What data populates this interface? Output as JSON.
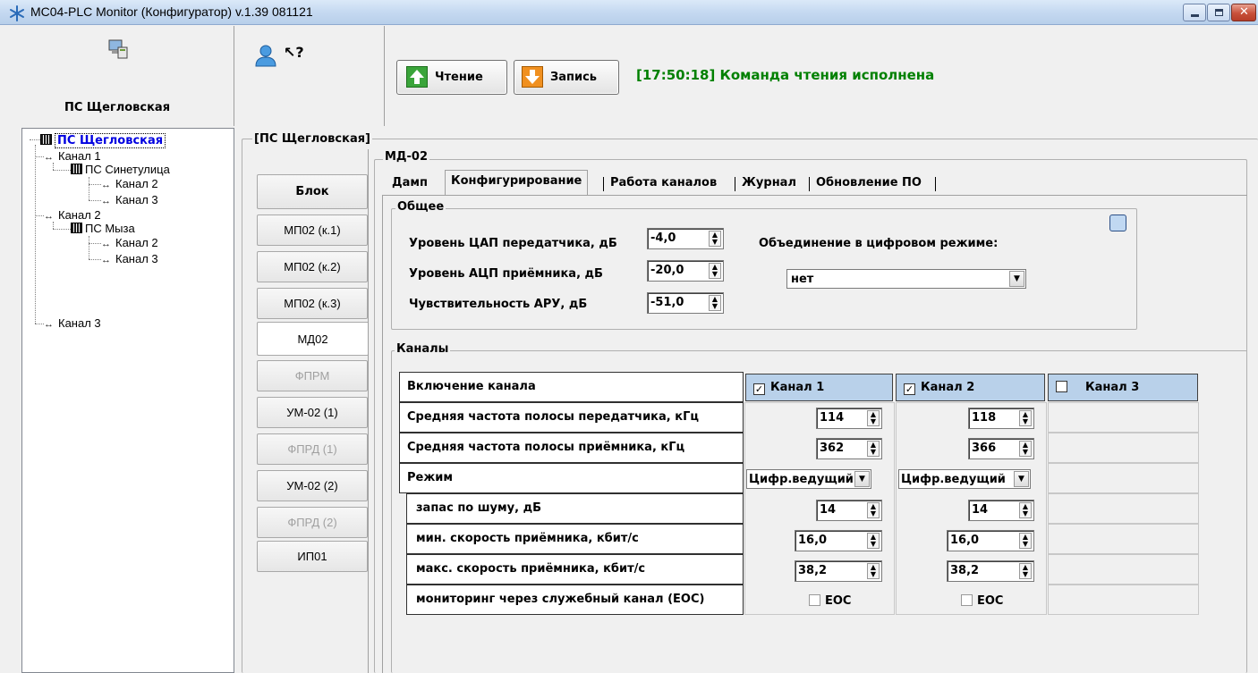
{
  "window": {
    "title": "MC04-PLC Monitor (Конфигуратор) v.1.39 081121",
    "icon": "snowflake-icon"
  },
  "left_header": {
    "station_name": "ПС Щегловская"
  },
  "tree": {
    "root": "ПС Щегловская",
    "items": [
      "Канал 1",
      "ПС Синетулица",
      "Канал 2",
      "Канал 3",
      "Канал 2",
      "ПС Мыза",
      "Канал 2",
      "Канал 3",
      "Канал 3"
    ]
  },
  "toolbar": {
    "read_label": "Чтение",
    "write_label": "Запись",
    "status": "[17:50:18] Команда чтения исполнена",
    "status_color": "#008000"
  },
  "block_group": {
    "title": "[ПС Щегловская]",
    "header_button": "Блок",
    "buttons": [
      "МП02 (к.1)",
      "МП02 (к.2)",
      "МП02 (к.3)",
      "МД02",
      "ФПРМ",
      "УМ-02 (1)",
      "ФПРД  (1)",
      "УМ-02 (2)",
      "ФПРД  (2)",
      "ИП01"
    ]
  },
  "module": {
    "title": "МД-02",
    "tabs": [
      "Дамп",
      "Конфигурирование",
      "Работа каналов",
      "Журнал",
      "Обновление ПО"
    ],
    "active_tab": "Конфигурирование"
  },
  "general": {
    "title": "Общее",
    "dac_label": "Уровень ЦАП передатчика, дБ",
    "dac_value": "-4,0",
    "adc_label": "Уровень АЦП приёмника, дБ",
    "adc_value": "-20,0",
    "agc_label": "Чувствительность АРУ, дБ",
    "agc_value": "-51,0",
    "combine_label": "Объединение в цифровом режиме:",
    "combine_value": "нет"
  },
  "channels": {
    "title": "Каналы",
    "header_label": "Включение канала",
    "channel_names": [
      "Канал 1",
      "Канал 2",
      "Канал 3"
    ],
    "channel_enabled": [
      true,
      true,
      false
    ],
    "rows": [
      "Средняя частота полосы передатчика, кГц",
      "Средняя частота полосы приёмника, кГц",
      "Режим",
      "запас по шуму, дБ",
      "мин. скорость приёмника, кбит/с",
      "макс. скорость приёмника, кбит/с",
      "мониторинг через служебный канал (EOC)"
    ],
    "ch1": {
      "tx": "114",
      "rx": "362",
      "mode": "Цифр.ведущий",
      "snr": "14",
      "min_rate": "16,0",
      "max_rate": "38,2",
      "eoc": "EOC"
    },
    "ch2": {
      "tx": "118",
      "rx": "366",
      "mode": "Цифр.ведущий",
      "snr": "14",
      "min_rate": "16,0",
      "max_rate": "38,2",
      "eoc": "EOC"
    }
  }
}
